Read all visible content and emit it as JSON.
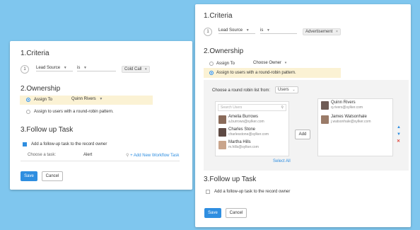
{
  "left": {
    "criteria": {
      "title": "1.Criteria",
      "number": "1",
      "field": "Lead Source",
      "operator": "is",
      "value": "Cold Call"
    },
    "ownership": {
      "title": "2.Ownership",
      "assign_to_label": "Assign To",
      "assign_to_value": "Quinn Rivers",
      "round_robin_label": "Assign to users with a round-robin pattern."
    },
    "followup": {
      "title": "3.Follow up Task",
      "checkbox_label": "Add a follow-up task to the record owner",
      "choose_task_label": "Choose a task:",
      "task_value": "Alert",
      "add_workflow_task": "+ Add New Workflow Task"
    },
    "buttons": {
      "save": "Save",
      "cancel": "Cancel"
    }
  },
  "right": {
    "criteria": {
      "title": "1.Criteria",
      "number": "1",
      "field": "Lead Source",
      "operator": "is",
      "value": "Advertisement"
    },
    "ownership": {
      "title": "2.Ownership",
      "assign_to_label": "Assign To",
      "assign_to_value": "Choose Owner",
      "round_robin_label": "Assign to users with a round-robin pattern.",
      "list_from_label": "Choose a round robin list from:",
      "list_from_value": "Users",
      "search_placeholder": "Search Users",
      "available_users": [
        {
          "name": "Amelia Burrows",
          "email": "a.burrows@sylker.com"
        },
        {
          "name": "Charles Stone",
          "email": "charlesstone@sylker.com"
        },
        {
          "name": "Martha Hills",
          "email": "m.hills@sylker.com"
        }
      ],
      "add_button": "Add",
      "select_all": "Select All",
      "selected_users": [
        {
          "name": "Quinn Rivers",
          "email": "q.rivers@sylker.com"
        },
        {
          "name": "James Watsonhale",
          "email": "j.watsonhale@sylker.com"
        }
      ]
    },
    "followup": {
      "title": "3.Follow up Task",
      "checkbox_label": "Add a follow-up task to the record owner"
    },
    "buttons": {
      "save": "Save",
      "cancel": "Cancel"
    }
  },
  "icons": {
    "dropdown": "chevron-down-icon",
    "search": "search-icon",
    "move_up": "arrow-up-icon",
    "move_down": "arrow-down-icon",
    "remove": "close-icon"
  },
  "colors": {
    "background": "#7fc6ee",
    "accent": "#2f8ee0",
    "highlight": "#fbf2d4",
    "remove": "#e0443a"
  }
}
